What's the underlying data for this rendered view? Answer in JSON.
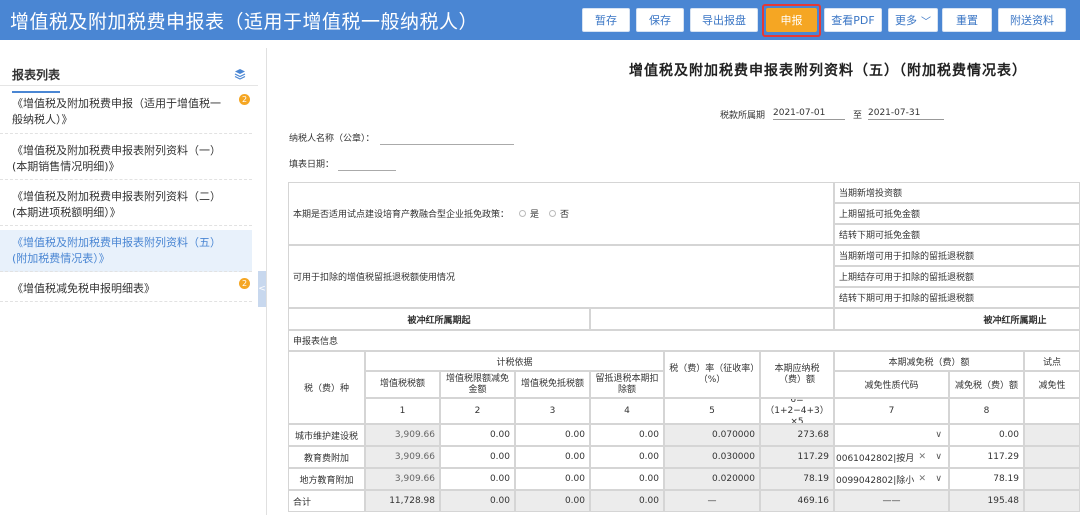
{
  "header": {
    "title": "增值税及附加税费申报表（适用于增值税一般纳税人）",
    "buttons": {
      "stash": "暂存",
      "save": "保存",
      "export": "导出报盘",
      "declare": "申报",
      "view_pdf": "查看PDF",
      "more": "更多",
      "reset": "重置",
      "attach": "附送资料"
    }
  },
  "sidebar": {
    "title": "报表列表",
    "items": [
      {
        "label": "《增值税及附加税费申报（适用于增值税一般纳税人）》",
        "badge": "2"
      },
      {
        "label": "《增值税及附加税费申报表附列资料（一）(本期销售情况明细)》",
        "badge": ""
      },
      {
        "label": "《增值税及附加税费申报表附列资料（二）(本期进项税额明细）》",
        "badge": ""
      },
      {
        "label": "《增值税及附加税费申报表附列资料（五）(附加税费情况表）》",
        "badge": ""
      },
      {
        "label": "《增值税减免税申报明细表》",
        "badge": "2"
      }
    ]
  },
  "doc": {
    "title": "增值税及附加税费申报表附列资料（五）（附加税费情况表）",
    "period_label": "税款所属期",
    "period_start": "2021-07-01",
    "period_to": "至",
    "period_end": "2021-07-31",
    "taxpayer_label": "纳税人名称（公章）：",
    "fill_date_label": "填表日期：",
    "pilot_policy_label": "本期是否适用试点建设培育产教融合型企业抵免政策：",
    "yes": "是",
    "no": "否",
    "pilot_right": [
      "当期新增投资额",
      "上期留抵可抵免金额",
      "结转下期可抵免金额"
    ],
    "retention_label": "可用于扣除的增值税留抵退税额使用情况",
    "retention_right": [
      "当期新增可用于扣除的留抵退税额",
      "上期结存可用于扣除的留抵退税额",
      "结转下期可用于扣除的留抵退税额"
    ],
    "red_start": "被冲红所属期起",
    "red_end": "被冲红所属期止",
    "section": "申报表信息",
    "headers": {
      "tax_type": "税（费）种",
      "basis": "计税依据",
      "vat_amount": "增值税税额",
      "vat_exempt": "增值税限额减免金额",
      "vat_credit": "增值税免抵税额",
      "retention_deduct": "留抵退税本期扣除额",
      "rate": "税（费）率（征收率）（%）",
      "payable": "本期应纳税（费）额",
      "reduction": "本期减免税（费）额",
      "reduction_code": "减免性质代码",
      "reduction_amount": "减免税（费）额",
      "pilot": "试点",
      "pilot_sub": "减免性",
      "idx": [
        "1",
        "2",
        "3",
        "4",
        "5",
        "6=（1+2−4+3）×5",
        "7",
        "8"
      ]
    },
    "rows": [
      {
        "name": "城市维护建设税",
        "c1": "3,909.66",
        "c2": "0.00",
        "c3": "0.00",
        "c4": "0.00",
        "c5": "0.070000",
        "c6": "273.68",
        "c7": "",
        "c8": "0.00"
      },
      {
        "name": "教育费附加",
        "c1": "3,909.66",
        "c2": "0.00",
        "c3": "0.00",
        "c4": "0.00",
        "c5": "0.030000",
        "c6": "117.29",
        "c7": "0061042802|按月",
        "c8": "117.29"
      },
      {
        "name": "地方教育附加",
        "c1": "3,909.66",
        "c2": "0.00",
        "c3": "0.00",
        "c4": "0.00",
        "c5": "0.020000",
        "c6": "78.19",
        "c7": "0099042802|除小",
        "c8": "78.19"
      },
      {
        "name": "合计",
        "c1": "11,728.98",
        "c2": "0.00",
        "c3": "0.00",
        "c4": "0.00",
        "c5": "—",
        "c6": "469.16",
        "c7": "——",
        "c8": "195.48"
      }
    ]
  }
}
